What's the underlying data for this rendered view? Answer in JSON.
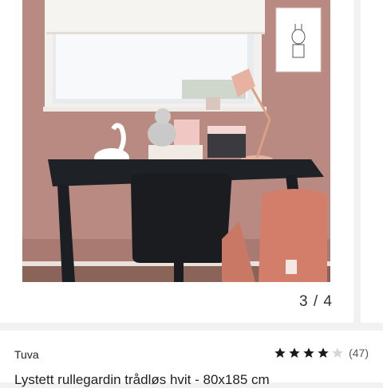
{
  "gallery": {
    "pager_text": "3 / 4",
    "image_alt": "Lystett rullegardin trådløs hvit i barnerom med skrivebord"
  },
  "product": {
    "brand": "Tuva",
    "title": "Lystett rullegardin trådløs hvit - 80x185 cm",
    "rating": {
      "stars": 4,
      "max_stars": 5,
      "count_text": "(47)"
    }
  },
  "colors": {
    "wall": "#b98a82",
    "star_filled": "#1a1a1a",
    "star_empty": "#d6d6d6"
  }
}
